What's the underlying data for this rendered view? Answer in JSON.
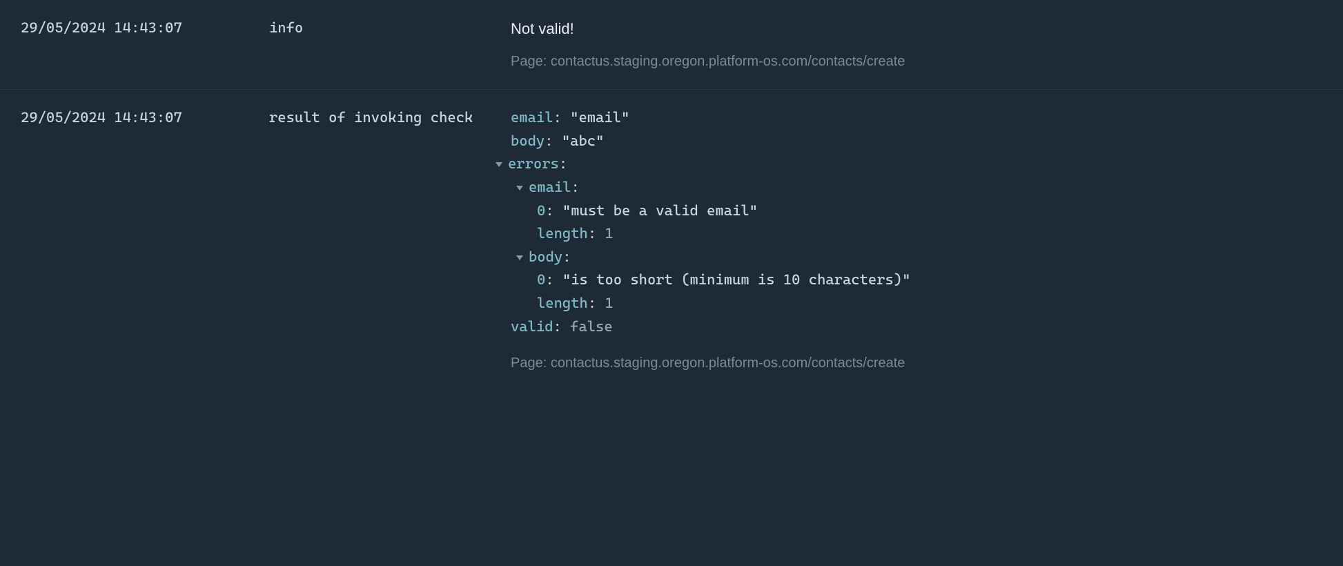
{
  "rows": [
    {
      "timestamp": "29/05/2024 14:43:07",
      "label": "info",
      "message": "Not valid!",
      "page_prefix": "Page: ",
      "page": "contactus.staging.oregon.platform-os.com/contacts/create"
    },
    {
      "timestamp": "29/05/2024 14:43:07",
      "label": "result of invoking check",
      "page_prefix": "Page: ",
      "page": "contactus.staging.oregon.platform-os.com/contacts/create",
      "data": {
        "email_key": "email",
        "email_val": "\"email\"",
        "body_key": "body",
        "body_val": "\"abc\"",
        "errors_key": "errors",
        "errors": {
          "email_key": "email",
          "email_0_key": "0",
          "email_0_val": "\"must be a valid email\"",
          "email_len_key": "length",
          "email_len_val": "1",
          "body_key": "body",
          "body_0_key": "0",
          "body_0_val": "\"is too short (minimum is 10 characters)\"",
          "body_len_key": "length",
          "body_len_val": "1"
        },
        "valid_key": "valid",
        "valid_val": "false"
      }
    }
  ]
}
